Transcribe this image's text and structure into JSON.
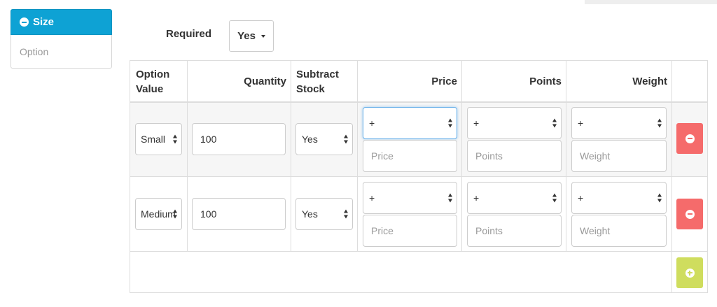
{
  "option_list": {
    "active_label": "Size",
    "items": [
      {
        "label": "Option"
      }
    ]
  },
  "required": {
    "label": "Required",
    "value": "Yes"
  },
  "table": {
    "headers": {
      "option_value": [
        "Option",
        "Value"
      ],
      "quantity": "Quantity",
      "subtract_stock": [
        "Subtract",
        "Stock"
      ],
      "price": "Price",
      "points": "Points",
      "weight": "Weight"
    },
    "rows": [
      {
        "option_value": "Small",
        "quantity": "100",
        "subtract": "Yes",
        "price_prefix": "+",
        "price_placeholder": "Price",
        "points_prefix": "+",
        "points_placeholder": "Points",
        "weight_prefix": "+",
        "weight_placeholder": "Weight"
      },
      {
        "option_value": "Medium",
        "quantity": "100",
        "subtract": "Yes",
        "price_prefix": "+",
        "price_placeholder": "Price",
        "points_prefix": "+",
        "points_placeholder": "Points",
        "weight_prefix": "+",
        "weight_placeholder": "Weight"
      }
    ]
  },
  "icons": {
    "active_tab": "minus-circle-icon",
    "remove": "minus-circle-icon",
    "add": "plus-circle-icon"
  },
  "colors": {
    "active_tab": "#0ea2d4",
    "remove_button": "#f56b6b",
    "add_button": "#cfdd5e",
    "focus_border": "#66afe9"
  }
}
